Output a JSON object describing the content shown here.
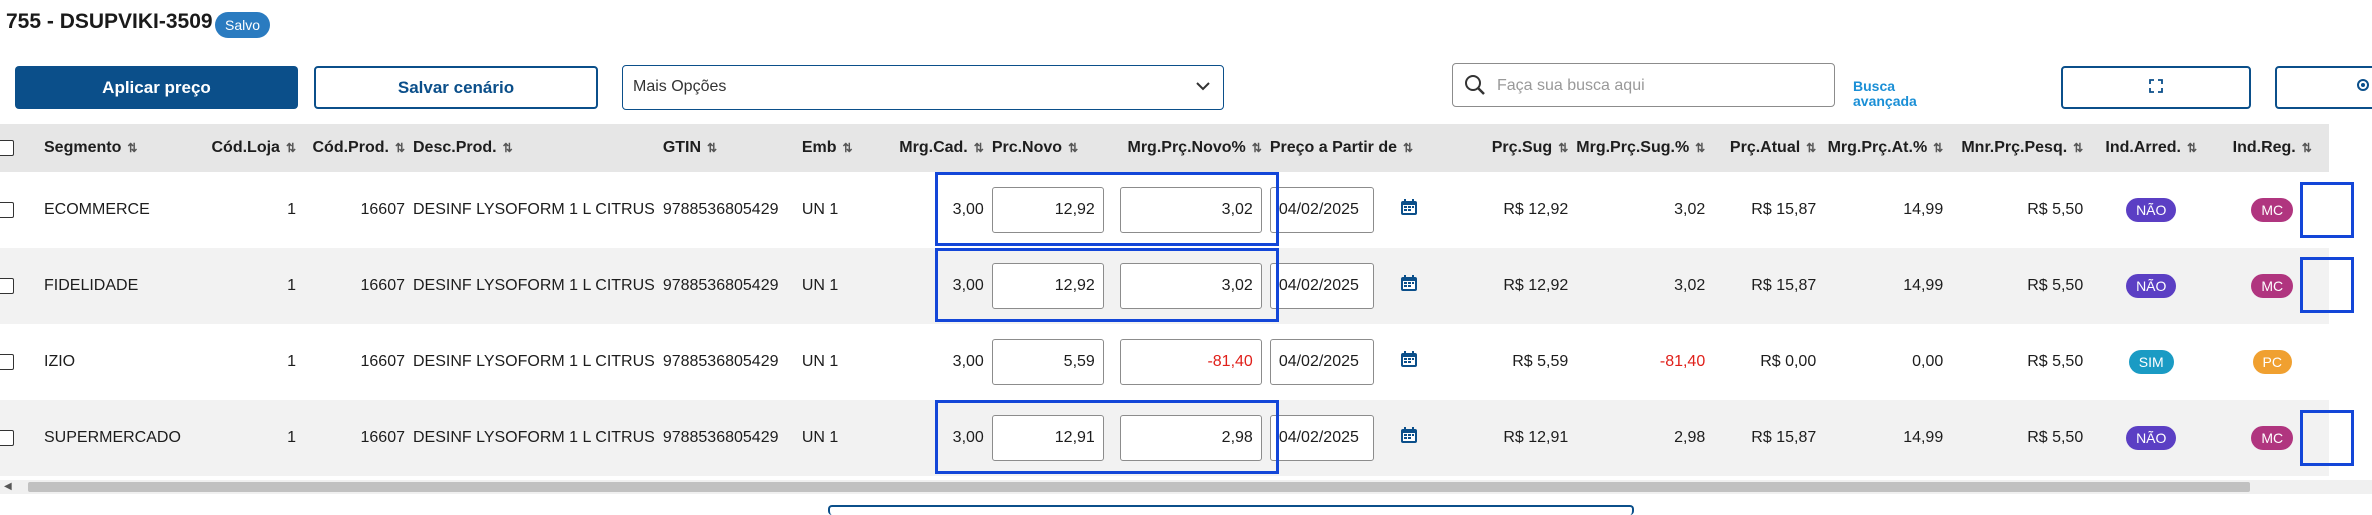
{
  "header": {
    "title": "755 - DSUPVIKI-3509",
    "status_badge": "Salvo"
  },
  "toolbar": {
    "apply_price_label": "Aplicar preço",
    "save_scenario_label": "Salvar cenário",
    "more_options_value": "Mais Opções",
    "search_placeholder": "Faça sua busca aqui",
    "advanced_search_label": "Busca avançada"
  },
  "grid": {
    "columns": [
      "Segmento",
      "Cód.Loja",
      "Cód.Prod.",
      "Desc.Prod.",
      "GTIN",
      "Emb",
      "Mrg.Cad.",
      "Prc.Novo",
      "Mrg.Prç.Novo%",
      "Preço a Partir de",
      "Prç.Sug",
      "Mrg.Prç.Sug.%",
      "Prç.Atual",
      "Mrg.Prç.At.%",
      "Mnr.Prç.Pesq.",
      "Ind.Arred.",
      "Ind.Reg."
    ],
    "rows": [
      {
        "segmento": "ECOMMERCE",
        "cod_loja": "1",
        "cod_prod": "16607",
        "desc_prod": "DESINF LYSOFORM 1 L CITRUS",
        "gtin": "9788536805429",
        "emb": "UN 1",
        "mrg_cad": "3,00",
        "prc_novo": "12,92",
        "mrg_prc_novo": "3,02",
        "preco_a_partir": "04/02/2025",
        "prc_sug": "R$ 12,92",
        "mrg_prc_sug": "3,02",
        "prc_atual": "R$ 15,87",
        "mrg_prc_at": "14,99",
        "mnr_prc_pesq": "R$ 5,50",
        "ind_arred": "NÃO",
        "ind_reg": "MC"
      },
      {
        "segmento": "FIDELIDADE",
        "cod_loja": "1",
        "cod_prod": "16607",
        "desc_prod": "DESINF LYSOFORM 1 L CITRUS",
        "gtin": "9788536805429",
        "emb": "UN 1",
        "mrg_cad": "3,00",
        "prc_novo": "12,92",
        "mrg_prc_novo": "3,02",
        "preco_a_partir": "04/02/2025",
        "prc_sug": "R$ 12,92",
        "mrg_prc_sug": "3,02",
        "prc_atual": "R$ 15,87",
        "mrg_prc_at": "14,99",
        "mnr_prc_pesq": "R$ 5,50",
        "ind_arred": "NÃO",
        "ind_reg": "MC"
      },
      {
        "segmento": "IZIO",
        "cod_loja": "1",
        "cod_prod": "16607",
        "desc_prod": "DESINF LYSOFORM 1 L CITRUS",
        "gtin": "9788536805429",
        "emb": "UN 1",
        "mrg_cad": "3,00",
        "prc_novo": "5,59",
        "mrg_prc_novo": "-81,40",
        "preco_a_partir": "04/02/2025",
        "prc_sug": "R$ 5,59",
        "mrg_prc_sug": "-81,40",
        "prc_atual": "R$ 0,00",
        "mrg_prc_at": "0,00",
        "mnr_prc_pesq": "R$ 5,50",
        "ind_arred": "SIM",
        "ind_reg": "PC"
      },
      {
        "segmento": "SUPERMERCADO",
        "cod_loja": "1",
        "cod_prod": "16607",
        "desc_prod": "DESINF LYSOFORM 1 L CITRUS",
        "gtin": "9788536805429",
        "emb": "UN 1",
        "mrg_cad": "3,00",
        "prc_novo": "12,91",
        "mrg_prc_novo": "2,98",
        "preco_a_partir": "04/02/2025",
        "prc_sug": "R$ 12,91",
        "mrg_prc_sug": "2,98",
        "prc_atual": "R$ 15,87",
        "mrg_prc_at": "14,99",
        "mnr_prc_pesq": "R$ 5,50",
        "ind_arred": "NÃO",
        "ind_reg": "MC"
      }
    ]
  },
  "colors": {
    "primary": "#0b4f8a",
    "highlight_border": "#1346d8",
    "negative": "#e0201a",
    "pill_nao": "#5b3fc4",
    "pill_sim": "#1a9bc4",
    "pill_mc": "#b0357f",
    "pill_pc": "#f0a030"
  },
  "icons": [
    "chevron-down-icon",
    "search-icon",
    "expand-icon",
    "gear-icon",
    "calendar-icon",
    "sort-icon"
  ]
}
